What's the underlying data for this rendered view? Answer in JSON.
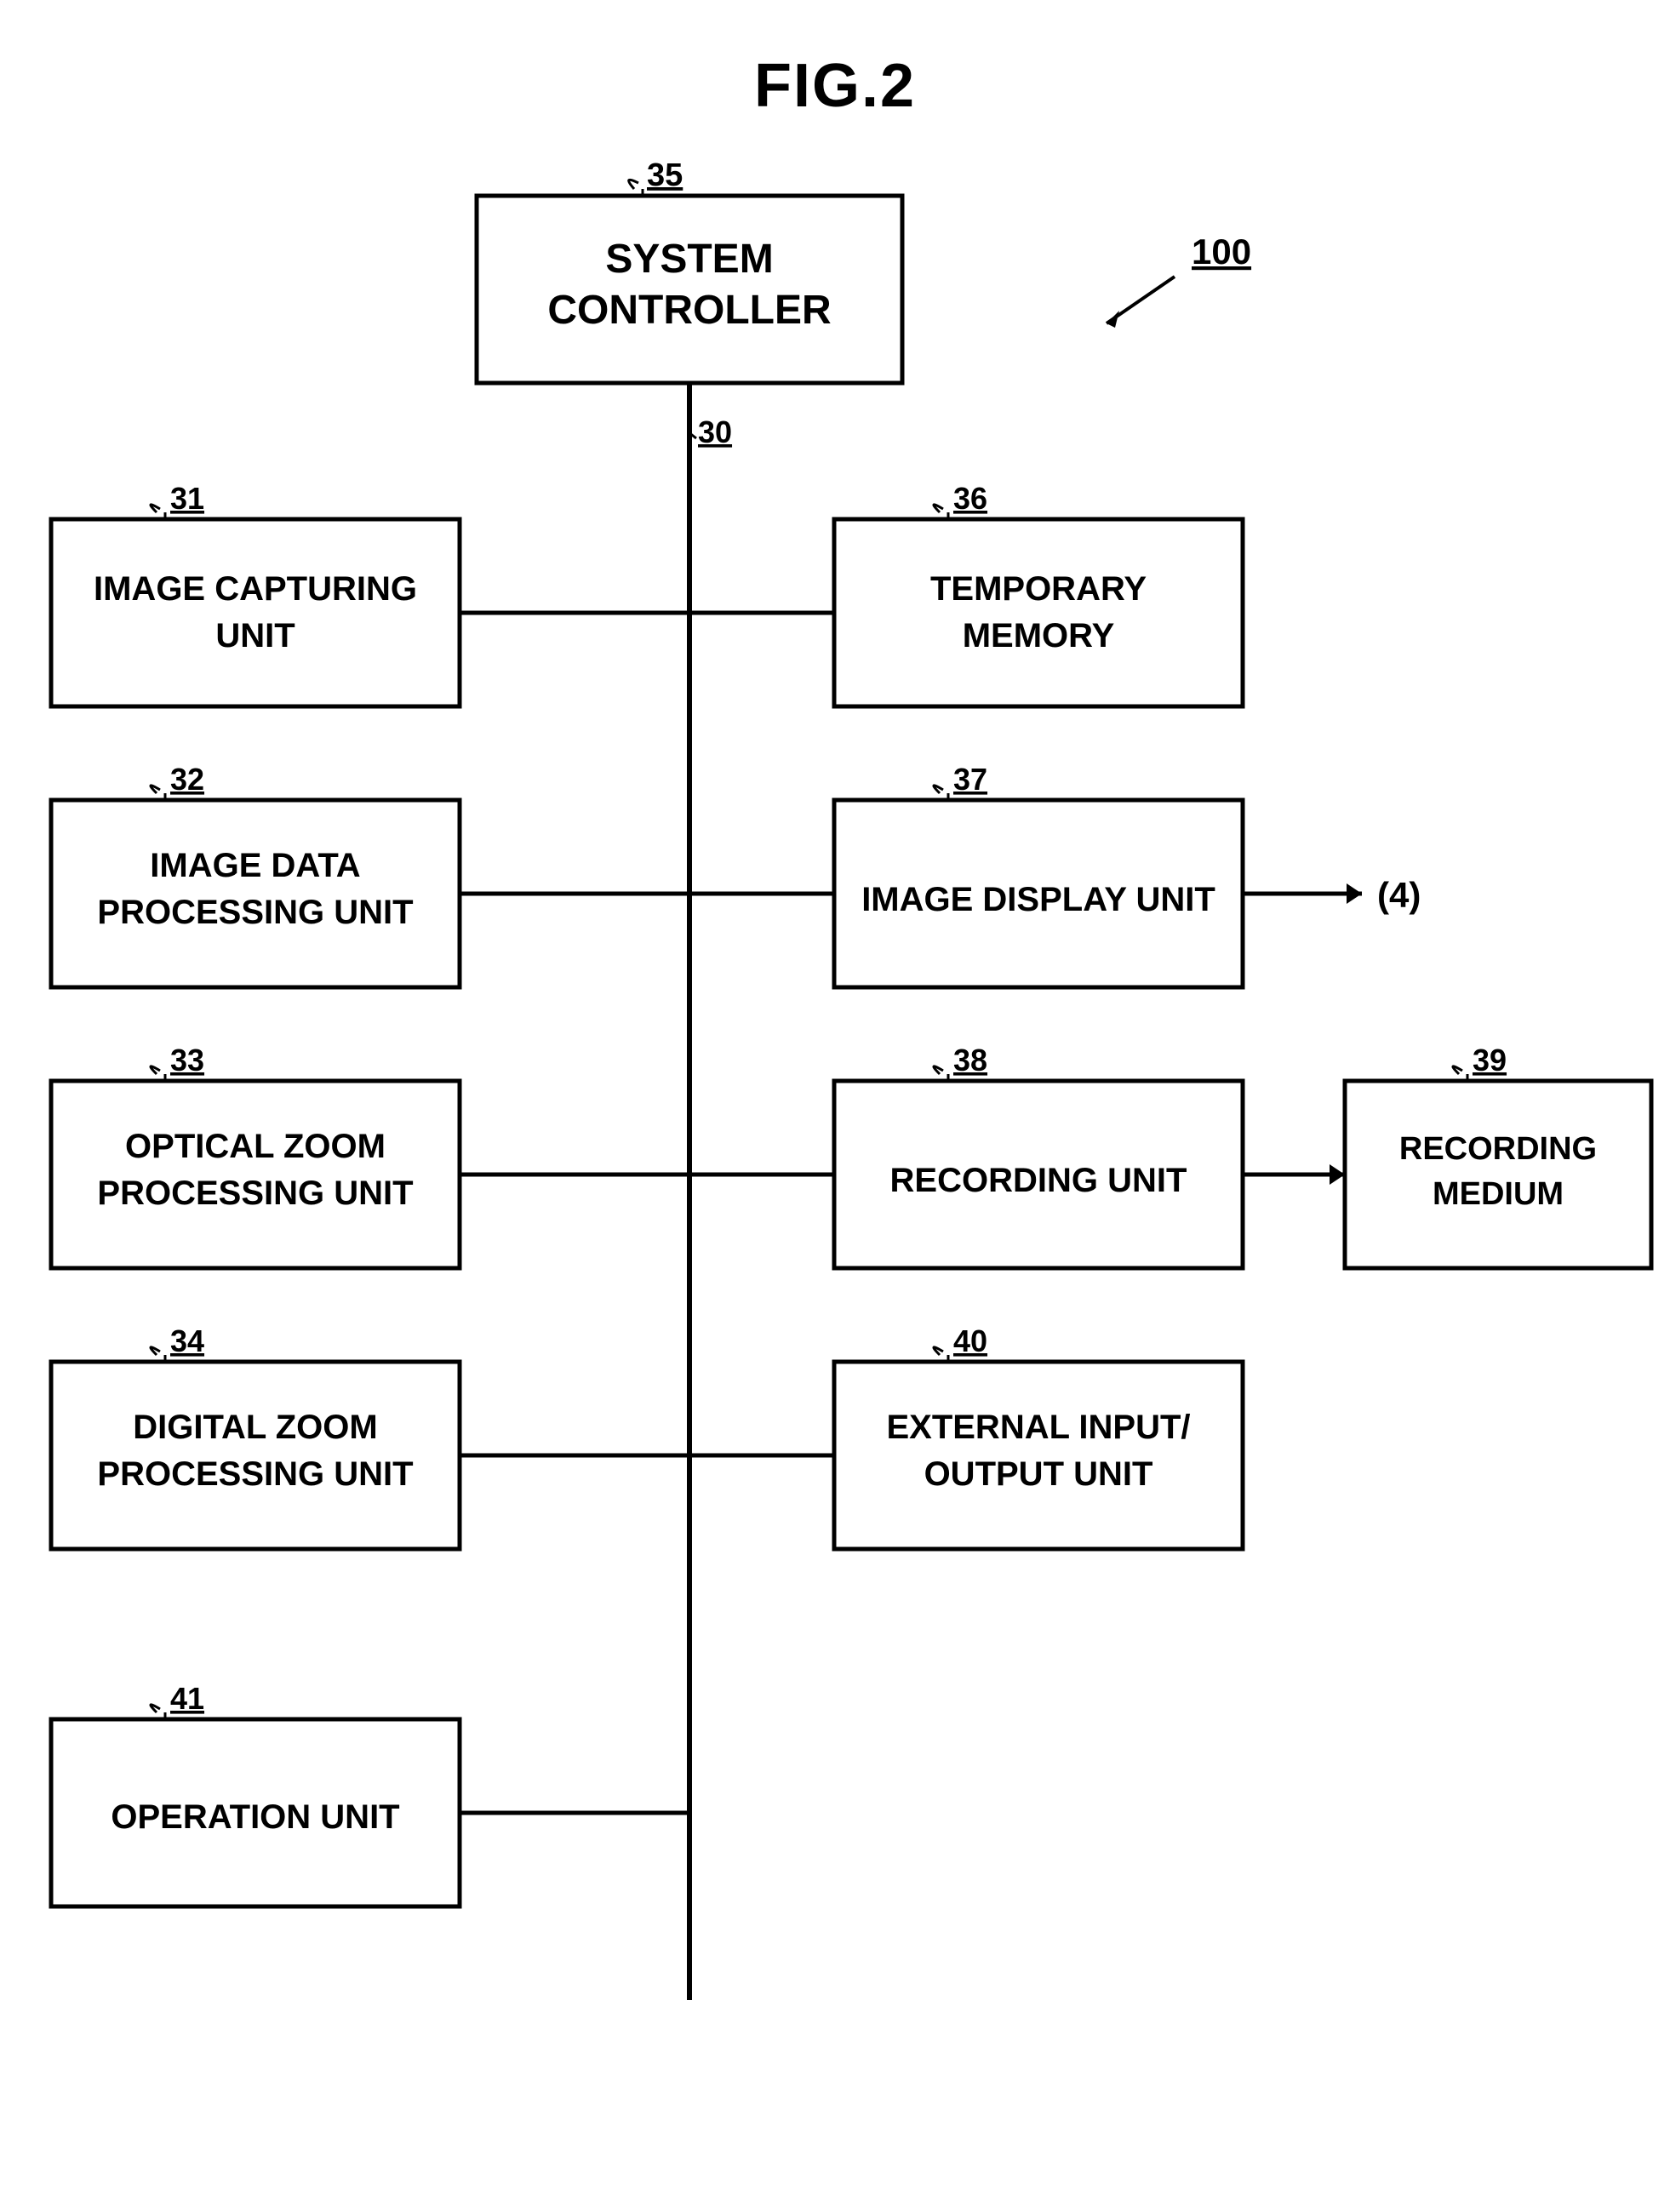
{
  "title": "FIG.2",
  "diagram_ref": "100",
  "boxes": {
    "system_controller": {
      "label": "SYSTEM\nCONTROLLER",
      "ref": "35"
    },
    "image_capturing": {
      "label": "IMAGE CAPTURING\nUNIT",
      "ref": "31"
    },
    "image_data_processing": {
      "label": "IMAGE DATA\nPROCESSING UNIT",
      "ref": "32"
    },
    "optical_zoom": {
      "label": "OPTICAL ZOOM\nPROCESSING UNIT",
      "ref": "33"
    },
    "digital_zoom": {
      "label": "DIGITAL ZOOM\nPROCESSING UNIT",
      "ref": "34"
    },
    "operation_unit": {
      "label": "OPERATION UNIT",
      "ref": "41"
    },
    "temporary_memory": {
      "label": "TEMPORARY\nMEMORY",
      "ref": "36"
    },
    "image_display": {
      "label": "IMAGE DISPLAY UNIT",
      "ref": "37"
    },
    "recording_unit": {
      "label": "RECORDING UNIT",
      "ref": "38"
    },
    "recording_medium": {
      "label": "RECORDING\nMEDIUM",
      "ref": "39"
    },
    "external_io": {
      "label": "EXTERNAL INPUT/\nOUTPUT UNIT",
      "ref": "40"
    }
  },
  "annotations": {
    "display_output": "(4)",
    "bus_ref": "30"
  }
}
